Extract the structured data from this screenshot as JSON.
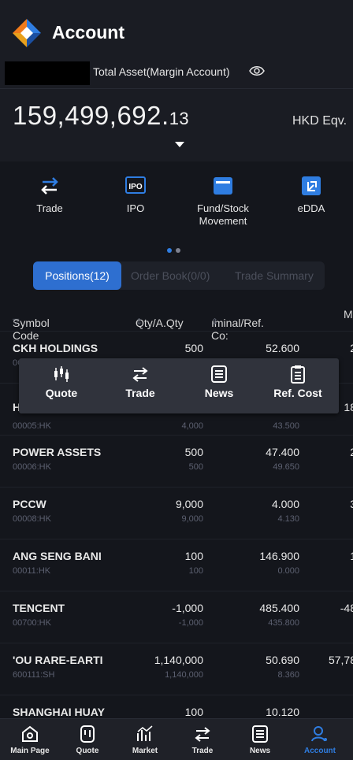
{
  "header": {
    "title": "Account",
    "asset_label": "Total Asset(Margin Account)",
    "amount_main": "159,499,692.",
    "amount_decimal": "13",
    "currency": "HKD Eqv."
  },
  "shortcuts": [
    {
      "label": "Trade",
      "icon": "trade-arrows-icon"
    },
    {
      "label": "IPO",
      "icon": "ipo-icon"
    },
    {
      "label": "Fund/Stock Movement",
      "icon": "wallet-icon"
    },
    {
      "label": "eDDA",
      "icon": "edda-icon"
    }
  ],
  "tabs": [
    {
      "label": "Positions(12)",
      "active": true
    },
    {
      "label": "Order Book(0/0)",
      "active": false
    },
    {
      "label": "Trade Summary",
      "active": false
    }
  ],
  "columns": {
    "symbol": "Symbol Code",
    "qty": "Qty/A.Qty",
    "nominal": "ıminal/Ref. Co:",
    "market": "M"
  },
  "rows": [
    {
      "name": "CKH HOLDINGS",
      "code": "0C",
      "qty": "500",
      "aqty": "",
      "nominal": "52.600",
      "ref": "",
      "market": "2"
    },
    {
      "name": "H",
      "code": "00005:HK",
      "qty": "",
      "aqty": "4,000",
      "nominal": "",
      "ref": "43.500",
      "market": "18"
    },
    {
      "name": "POWER ASSETS",
      "code": "00006:HK",
      "qty": "500",
      "aqty": "500",
      "nominal": "47.400",
      "ref": "49.650",
      "market": "2"
    },
    {
      "name": "PCCW",
      "code": "00008:HK",
      "qty": "9,000",
      "aqty": "9,000",
      "nominal": "4.000",
      "ref": "4.130",
      "market": "3"
    },
    {
      "name": "ANG SENG BANI",
      "code": "00011:HK",
      "qty": "100",
      "aqty": "100",
      "nominal": "146.900",
      "ref": "0.000",
      "market": "1"
    },
    {
      "name": "TENCENT",
      "code": "00700:HK",
      "qty": "-1,000",
      "aqty": "-1,000",
      "nominal": "485.400",
      "ref": "435.800",
      "market": "-48"
    },
    {
      "name": "'OU RARE-EARTI",
      "code": "600111:SH",
      "qty": "1,140,000",
      "aqty": "1,140,000",
      "nominal": "50.690",
      "ref": "8.360",
      "market": "57,78"
    },
    {
      "name": "SHANGHAI HUAY",
      "code": "",
      "qty": "100",
      "aqty": "",
      "nominal": "10.120",
      "ref": "",
      "market": ""
    }
  ],
  "popup": [
    {
      "label": "Quote",
      "icon": "candlestick-icon"
    },
    {
      "label": "Trade",
      "icon": "trade-arrows-icon"
    },
    {
      "label": "News",
      "icon": "news-icon"
    },
    {
      "label": "Ref. Cost",
      "icon": "clipboard-icon"
    }
  ],
  "bottom_nav": [
    {
      "label": "Main Page",
      "icon": "home-icon"
    },
    {
      "label": "Quote",
      "icon": "quote-icon"
    },
    {
      "label": "Market",
      "icon": "market-icon"
    },
    {
      "label": "Trade",
      "icon": "trade-arrows-icon"
    },
    {
      "label": "News",
      "icon": "news-icon"
    },
    {
      "label": "Account",
      "icon": "account-icon",
      "active": true
    }
  ],
  "colors": {
    "accent": "#2f7de1",
    "background": "#14161c"
  }
}
